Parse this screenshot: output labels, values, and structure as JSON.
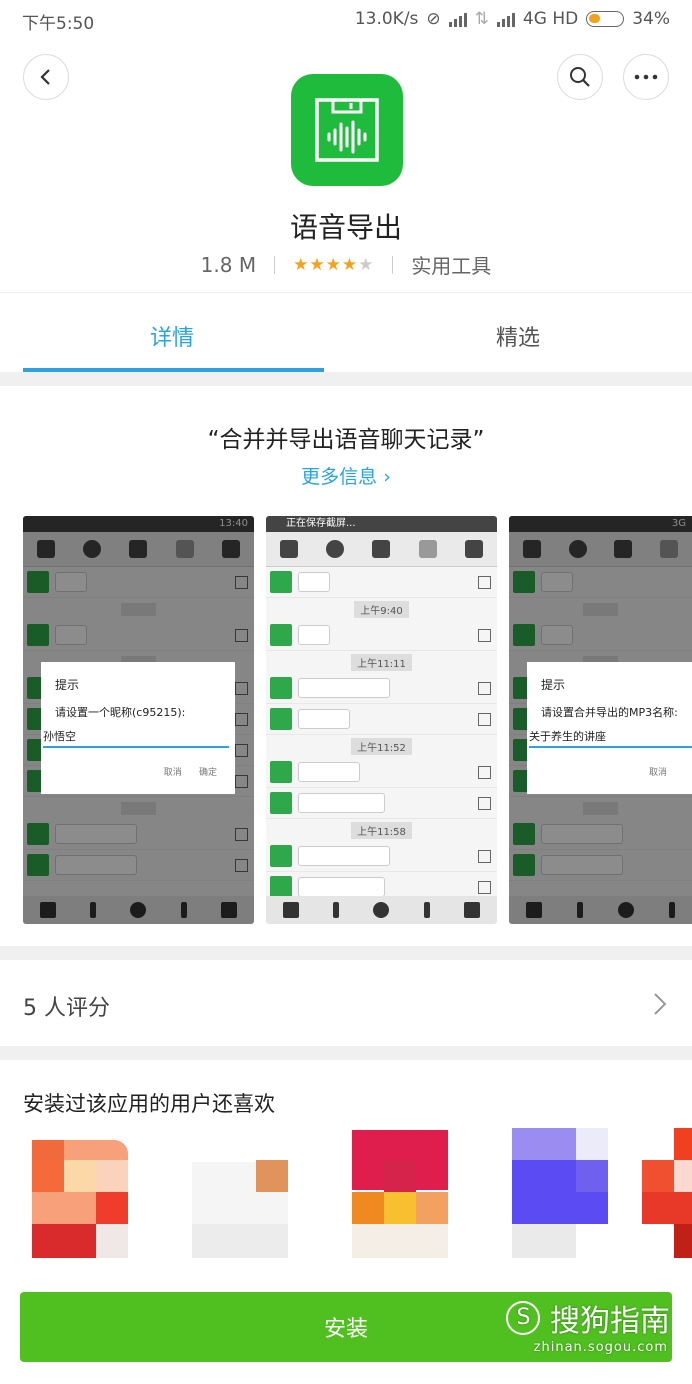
{
  "status_bar": {
    "time": "下午5:50",
    "net_speed": "13.0K/s",
    "network": "4G HD",
    "battery": "34%"
  },
  "app": {
    "name": "语音导出",
    "size": "1.8 M",
    "rating_stars": 4,
    "category": "实用工具"
  },
  "tabs": [
    {
      "label": "详情",
      "active": true
    },
    {
      "label": "精选",
      "active": false
    }
  ],
  "description": {
    "headline": "“合并并导出语音聊天记录”",
    "more_link": "更多信息 ›"
  },
  "screenshots": [
    {
      "status": "13:40",
      "dialog_title": "提示",
      "dialog_message": "请设置一个昵称(c95215):",
      "dialog_value": "孙悟空",
      "cancel": "取消",
      "confirm": "确定"
    },
    {
      "status": "正在保存截屏...",
      "times": [
        "上午9:40",
        "上午11:11",
        "上午11:52",
        "上午11:58"
      ]
    },
    {
      "status": "3G",
      "dialog_title": "提示",
      "dialog_message": "请设置合并导出的MP3名称:",
      "dialog_value": "关于养生的讲座",
      "cancel": "取消"
    }
  ],
  "ratings": {
    "label": "5 人评分"
  },
  "recommendations": {
    "title": "安装过该应用的用户还喜欢"
  },
  "install_button": {
    "label": "安装"
  },
  "watermark": {
    "brand": "搜狗指南",
    "url": "zhinan.sogou.com"
  },
  "colors": {
    "accent": "#2aa3df",
    "brand_green": "#1fbb3c",
    "install_green": "#4fc01f",
    "star": "#f2a31b"
  }
}
